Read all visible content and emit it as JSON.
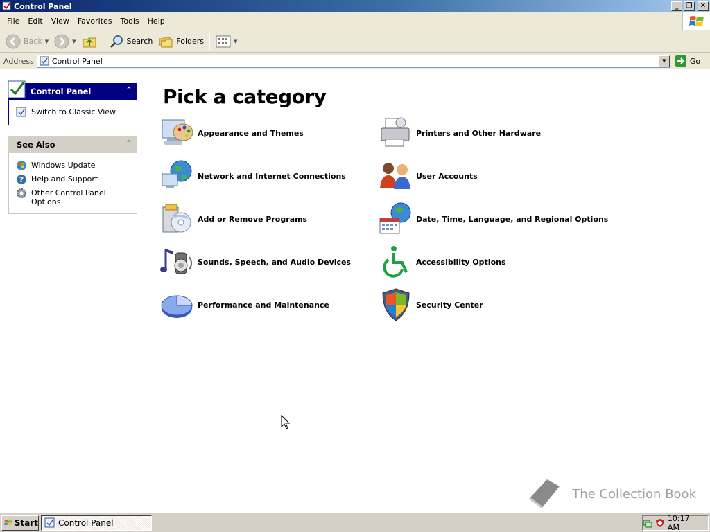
{
  "window": {
    "title": "Control Panel"
  },
  "menu": [
    "File",
    "Edit",
    "View",
    "Favorites",
    "Tools",
    "Help"
  ],
  "toolbar": {
    "back": "Back",
    "search": "Search",
    "folders": "Folders"
  },
  "address": {
    "label": "Address",
    "value": "Control Panel",
    "go": "Go"
  },
  "sidebar": {
    "control_panel": {
      "title": "Control Panel",
      "switch_view": "Switch to Classic View"
    },
    "see_also": {
      "title": "See Also",
      "items": [
        "Windows Update",
        "Help and Support",
        "Other Control Panel Options"
      ]
    }
  },
  "main": {
    "headline": "Pick a category",
    "categories": [
      {
        "label": "Appearance and Themes",
        "icon": "appearance-themes-icon"
      },
      {
        "label": "Printers and Other Hardware",
        "icon": "printers-hardware-icon"
      },
      {
        "label": "Network and Internet Connections",
        "icon": "network-internet-icon"
      },
      {
        "label": "User Accounts",
        "icon": "user-accounts-icon"
      },
      {
        "label": "Add or Remove Programs",
        "icon": "add-remove-programs-icon"
      },
      {
        "label": "Date, Time, Language, and Regional Options",
        "icon": "date-time-language-icon"
      },
      {
        "label": "Sounds, Speech, and Audio Devices",
        "icon": "sounds-audio-icon"
      },
      {
        "label": "Accessibility Options",
        "icon": "accessibility-icon"
      },
      {
        "label": "Performance and Maintenance",
        "icon": "performance-maintenance-icon"
      },
      {
        "label": "Security Center",
        "icon": "security-center-icon"
      }
    ]
  },
  "watermark": "The Collection Book",
  "taskbar": {
    "start": "Start",
    "task": "Control Panel",
    "clock": "10:17 AM"
  },
  "colors": {
    "titlebar": "#0a246a",
    "pane_header": "#000080",
    "face": "#d4d0c8"
  }
}
